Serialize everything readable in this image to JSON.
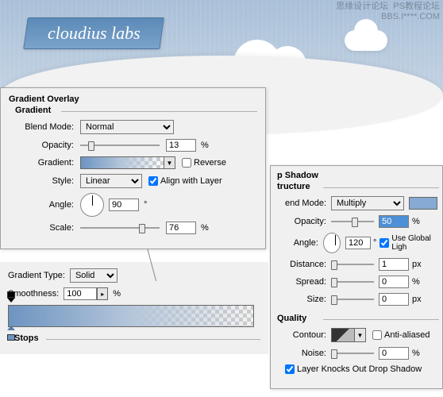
{
  "logo": "cloudius labs",
  "watermark": {
    "line1": "思缘设计论坛",
    "line2": "BBS.I****.COM",
    "line3": "PS教程论坛"
  },
  "gradientOverlay": {
    "title": "Gradient Overlay",
    "subtitle": "Gradient",
    "blendMode": {
      "label": "Blend Mode:",
      "value": "Normal"
    },
    "opacity": {
      "label": "Opacity:",
      "value": "13",
      "unit": "%"
    },
    "gradient": {
      "label": "Gradient:",
      "reverse": "Reverse"
    },
    "style": {
      "label": "Style:",
      "value": "Linear",
      "align": "Align with Layer"
    },
    "angle": {
      "label": "Angle:",
      "value": "90",
      "unit": "°"
    },
    "scale": {
      "label": "Scale:",
      "value": "76",
      "unit": "%"
    }
  },
  "gradientEditor": {
    "typeLabel": "Gradient Type:",
    "typeValue": "Solid",
    "smoothLabel": "Smoothness:",
    "smoothValue": "100",
    "smoothUnit": "%",
    "stopsLabel": "Stops"
  },
  "dropShadow": {
    "title": "p Shadow",
    "subtitle": "tructure",
    "blendMode": {
      "label": "end Mode:",
      "value": "Multiply"
    },
    "opacity": {
      "label": "Opacity:",
      "value": "50",
      "unit": "%"
    },
    "angle": {
      "label": "Angle:",
      "value": "120",
      "unit": "°",
      "global": "Use Global Ligh"
    },
    "distance": {
      "label": "Distance:",
      "value": "1",
      "unit": "px"
    },
    "spread": {
      "label": "Spread:",
      "value": "0",
      "unit": "%"
    },
    "size": {
      "label": "Size:",
      "value": "0",
      "unit": "px"
    },
    "quality": "Quality",
    "contour": {
      "label": "Contour:",
      "anti": "Anti-aliased"
    },
    "noise": {
      "label": "Noise:",
      "value": "0",
      "unit": "%"
    },
    "knockout": "Layer Knocks Out Drop Shadow"
  }
}
